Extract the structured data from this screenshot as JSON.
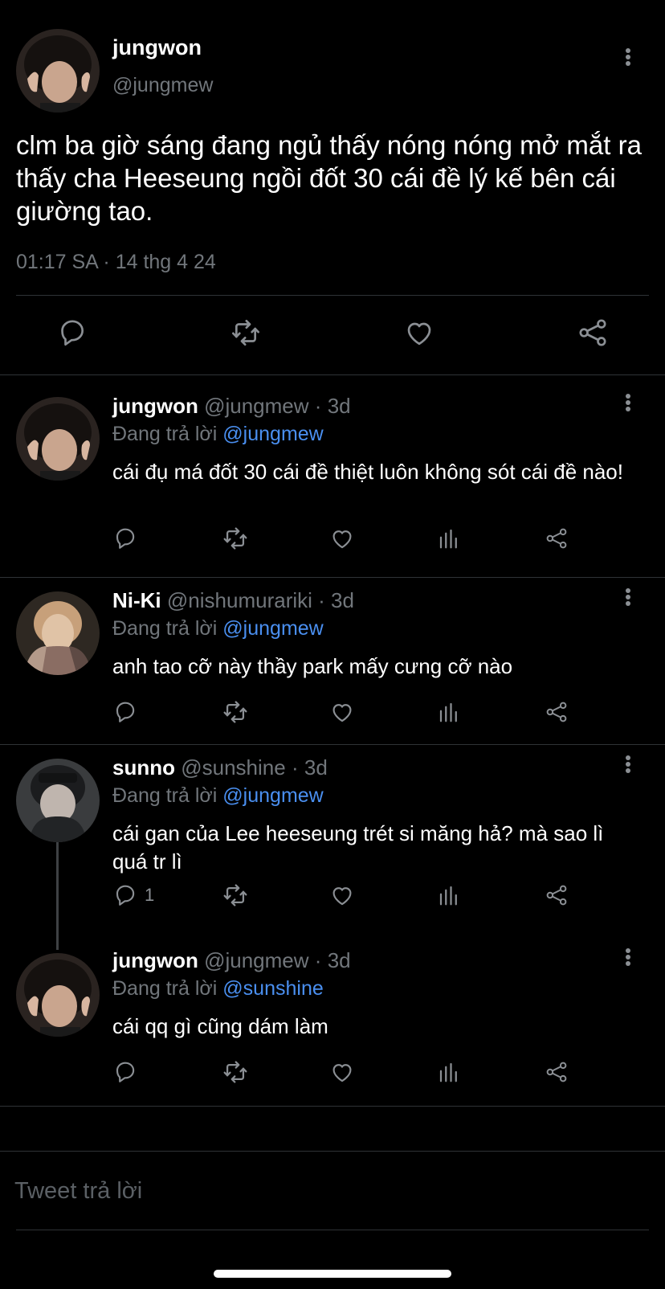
{
  "main_tweet": {
    "author_name": "jungwon",
    "author_handle": "@jungmew",
    "text": "clm ba giờ sáng đang ngủ thấy nóng nóng mở mắt ra thấy cha Heeseung ngồi đốt 30 cái đề lý kế bên cái giường tao.",
    "timestamp": "01:17 SA · 14 thg 4 24",
    "actions": [
      "reply-icon",
      "retweet-icon",
      "like-icon",
      "share-icon"
    ]
  },
  "replies": [
    {
      "author_name": "jungwon",
      "author_handle": "@jungmew",
      "time": "3d",
      "replying_prefix": "Đang trả lời",
      "replying_to": "@jungmew",
      "text": "cái đụ má  đốt 30 cái đề thiệt luôn không sót cái đề nào!",
      "reply_count": ""
    },
    {
      "author_name": "Ni-Ki",
      "author_handle": "@nishumurariki",
      "time": "3d",
      "replying_prefix": "Đang trả lời",
      "replying_to": "@jungmew",
      "text": "anh tao cỡ này thầy park mấy cưng cỡ nào",
      "reply_count": ""
    },
    {
      "author_name": "sunno",
      "author_handle": "@sunshine",
      "time": "3d",
      "replying_prefix": "Đang trả lời",
      "replying_to": "@jungmew",
      "text": "cái gan của Lee heeseung trét si măng hả? mà sao lì quá tr lì",
      "reply_count": "1"
    },
    {
      "author_name": "jungwon",
      "author_handle": "@jungmew",
      "time": "3d",
      "replying_prefix": "Đang trả lời",
      "replying_to": "@sunshine",
      "text": "cái qq gì cũng dám làm",
      "reply_count": ""
    }
  ],
  "reply_input": {
    "placeholder": "Tweet trả lời"
  },
  "colors": {
    "background": "#000000",
    "text": "#ffffff",
    "secondary": "#71767b",
    "mention": "#4a8ff0",
    "divider": "#2f3336"
  }
}
